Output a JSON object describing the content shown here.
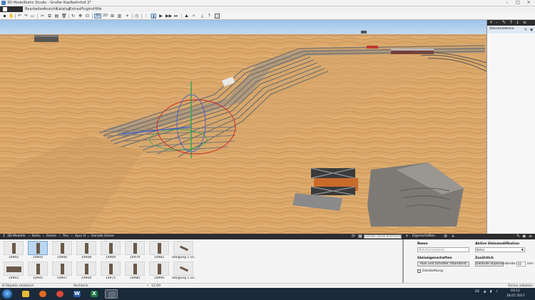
{
  "window": {
    "title": "3D-Modellbahn Studio - Großer Kopfbahnhof 2*",
    "minimize_icon": "minimize-icon",
    "maximize_icon": "maximize-icon",
    "close_icon": "close-icon"
  },
  "menu": {
    "items": [
      "Bearbeiten",
      "Ansicht",
      "Katalog",
      "Extras",
      "Plugins",
      "Hilfe"
    ]
  },
  "toolbar": {
    "view_3d": "3D",
    "view_2d": "2D"
  },
  "layers": {
    "active_layer": "Standardebene"
  },
  "catalog": {
    "breadcrumb": [
      "3D-Modelle",
      "Bahn",
      "Gleise",
      "Trix",
      "Spur H",
      "Gerade Gleise"
    ],
    "search_placeholder": "Gerade Gleise durchsuchen...",
    "row1": [
      "14902",
      "14904",
      "14906",
      "14908",
      "14969",
      "14979",
      "14982",
      "Steigung 1 Gra..."
    ],
    "row2": [
      "14903",
      "14905",
      "14907",
      "14909",
      "14975",
      "14980",
      "14990",
      "Steigung 1 Gra..."
    ],
    "selected_item": "14904"
  },
  "properties": {
    "panel_title": "Eigenschaften",
    "name_label": "Name",
    "name_placeholder": "Mehrfachselektion",
    "track_props_label": "Gleiseigenschaften",
    "sleepers_button": "Holz und Schotter (Standard)",
    "track_bedding_label": "Gleisbettung",
    "track_bedding_checked": true,
    "active_mod_label": "Aktive Gleismodifikation",
    "active_mod_value": "Keine",
    "extra_label": "Zusätzlich",
    "adjust_terrain_button": "Gelände anpassen",
    "width_label": "Breite:",
    "width_value": "60",
    "width_unit": "mm"
  },
  "status": {
    "selection": "8 Objekte selektiert",
    "mode": "Rechteck",
    "time": "12:00",
    "online": "Online arbeiten"
  },
  "taskbar": {
    "language": "DE",
    "clock_time": "03:12",
    "clock_date": "18.07.2017"
  },
  "colors": {
    "sky": "#a8c9ea",
    "sand": "#d9a869",
    "panel_dark": "#2d2d30",
    "selection": "#bcd6f0"
  }
}
